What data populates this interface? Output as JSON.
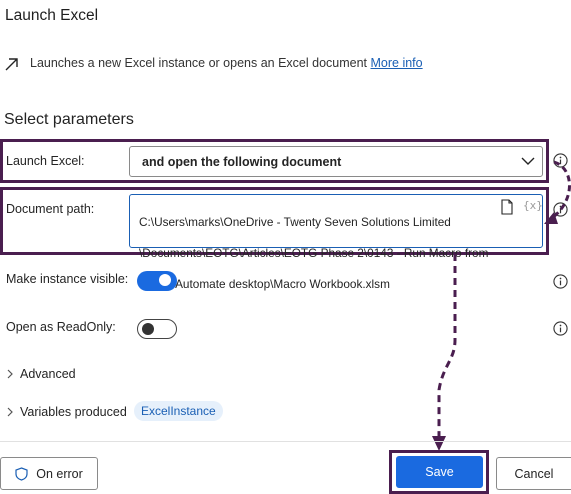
{
  "header": {
    "title": "Launch Excel"
  },
  "description": {
    "icon": "arrow-up-right-icon",
    "text": "Launches a new Excel instance or opens an Excel document",
    "link": "More info"
  },
  "parameters": {
    "heading": "Select parameters",
    "launch_excel": {
      "label": "Launch Excel:",
      "value": "and open the following document"
    },
    "document_path": {
      "label": "Document path:",
      "value": "C:\\Users\\marks\\OneDrive - Twenty Seven Solutions Limited \\Documents\\EOTG\\Articles\\EOTG Phase 2\\0143 - Run Macro from Power Automate desktop\\Macro Workbook.xlsm",
      "line1": "C:\\Users\\marks\\OneDrive - Twenty Seven Solutions Limited",
      "line2": "\\Documents\\EOTG\\Articles\\EOTG Phase 2\\0143 - Run Macro from",
      "line3": "Power Automate desktop\\Macro Workbook.xlsm",
      "var_button": "{x}"
    },
    "make_visible": {
      "label": "Make instance visible:",
      "checked": true
    },
    "read_only": {
      "label": "Open as ReadOnly:",
      "checked": false
    }
  },
  "advanced": {
    "label": "Advanced"
  },
  "variables": {
    "label": "Variables produced",
    "badge": "ExcelInstance"
  },
  "footer": {
    "on_error": "On error",
    "save": "Save",
    "cancel": "Cancel"
  },
  "colors": {
    "accent": "#1a6ae0",
    "highlight": "#4a1e4f",
    "link": "#1a5fb4"
  }
}
